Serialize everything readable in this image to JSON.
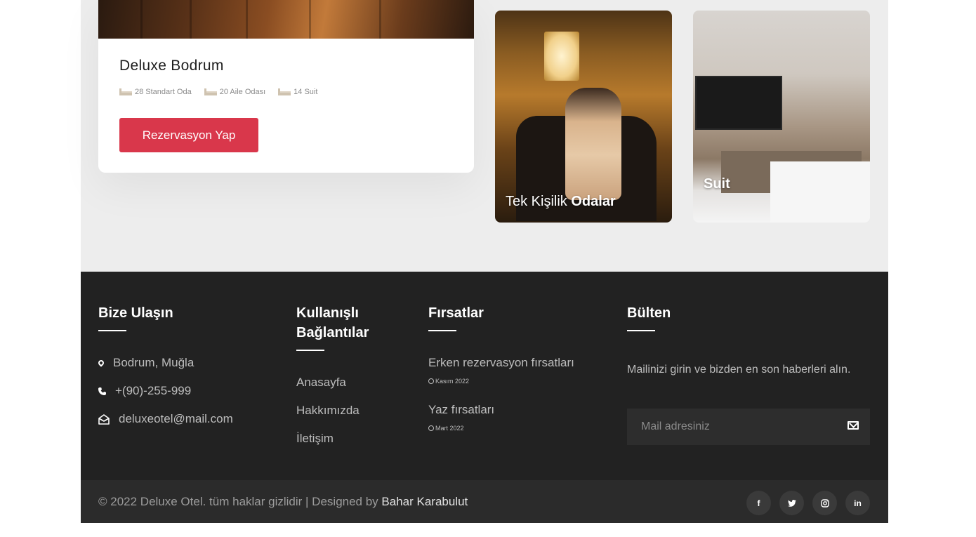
{
  "hotel_card": {
    "title": "Deluxe Bodrum",
    "features": [
      "28 Standart Oda",
      "20 Aile Odası",
      "14 Suit"
    ],
    "button_label": "Rezervasyon Yap"
  },
  "room_tiles": [
    {
      "label_normal": "Tek Kişilik ",
      "label_bold": "Odalar"
    },
    {
      "label_normal": "",
      "label_bold": "Suit"
    }
  ],
  "footer": {
    "contact": {
      "heading": "Bize Ulaşın",
      "location": "Bodrum, Muğla",
      "phone": "+(90)-255-999",
      "email": "deluxeotel@mail.com"
    },
    "links": {
      "heading_line1": "Kullanışlı",
      "heading_line2": "Bağlantılar",
      "items": [
        "Anasayfa",
        "Hakkımızda",
        "İletişim"
      ]
    },
    "deals": {
      "heading": "Fırsatlar",
      "items": [
        {
          "title": "Erken rezervasyon fırsatları",
          "date": "Kasım 2022"
        },
        {
          "title": "Yaz fırsatları",
          "date": "Mart 2022"
        }
      ]
    },
    "newsletter": {
      "heading": "Bülten",
      "text": "Mailinizi girin ve bizden en son haberleri alın.",
      "placeholder": "Mail adresiniz"
    }
  },
  "bottom_bar": {
    "copyright": "© 2022 Deluxe Otel. tüm haklar gizlidir | Designed by ",
    "designer": "Bahar Karabulut",
    "socials": [
      "f",
      "t",
      "ig",
      "in"
    ]
  },
  "colors": {
    "accent": "#d9374b",
    "footer_bg": "#222222",
    "bottom_bg": "#2b2b2b"
  }
}
